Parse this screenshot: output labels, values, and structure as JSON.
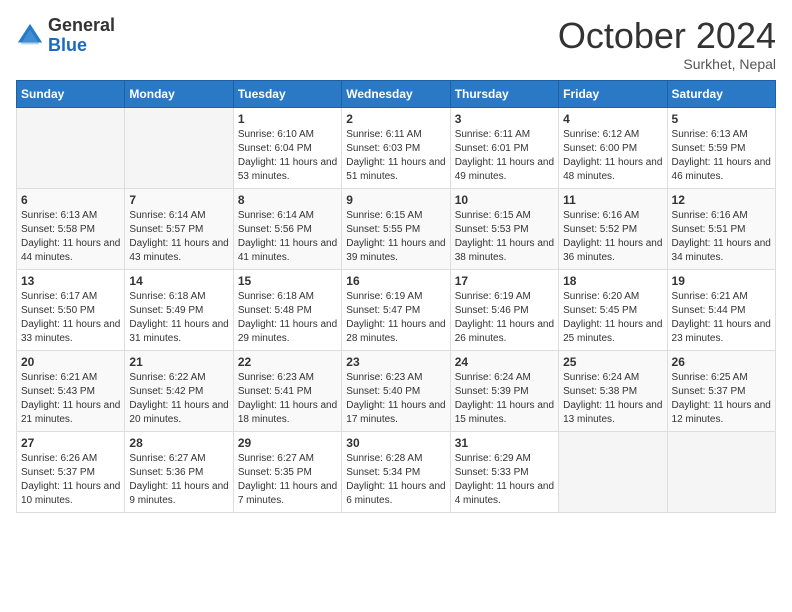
{
  "logo": {
    "general": "General",
    "blue": "Blue"
  },
  "header": {
    "month": "October 2024",
    "location": "Surkhet, Nepal"
  },
  "weekdays": [
    "Sunday",
    "Monday",
    "Tuesday",
    "Wednesday",
    "Thursday",
    "Friday",
    "Saturday"
  ],
  "weeks": [
    [
      {
        "day": "",
        "sunrise": "",
        "sunset": "",
        "daylight": ""
      },
      {
        "day": "",
        "sunrise": "",
        "sunset": "",
        "daylight": ""
      },
      {
        "day": "1",
        "sunrise": "Sunrise: 6:10 AM",
        "sunset": "Sunset: 6:04 PM",
        "daylight": "Daylight: 11 hours and 53 minutes."
      },
      {
        "day": "2",
        "sunrise": "Sunrise: 6:11 AM",
        "sunset": "Sunset: 6:03 PM",
        "daylight": "Daylight: 11 hours and 51 minutes."
      },
      {
        "day": "3",
        "sunrise": "Sunrise: 6:11 AM",
        "sunset": "Sunset: 6:01 PM",
        "daylight": "Daylight: 11 hours and 49 minutes."
      },
      {
        "day": "4",
        "sunrise": "Sunrise: 6:12 AM",
        "sunset": "Sunset: 6:00 PM",
        "daylight": "Daylight: 11 hours and 48 minutes."
      },
      {
        "day": "5",
        "sunrise": "Sunrise: 6:13 AM",
        "sunset": "Sunset: 5:59 PM",
        "daylight": "Daylight: 11 hours and 46 minutes."
      }
    ],
    [
      {
        "day": "6",
        "sunrise": "Sunrise: 6:13 AM",
        "sunset": "Sunset: 5:58 PM",
        "daylight": "Daylight: 11 hours and 44 minutes."
      },
      {
        "day": "7",
        "sunrise": "Sunrise: 6:14 AM",
        "sunset": "Sunset: 5:57 PM",
        "daylight": "Daylight: 11 hours and 43 minutes."
      },
      {
        "day": "8",
        "sunrise": "Sunrise: 6:14 AM",
        "sunset": "Sunset: 5:56 PM",
        "daylight": "Daylight: 11 hours and 41 minutes."
      },
      {
        "day": "9",
        "sunrise": "Sunrise: 6:15 AM",
        "sunset": "Sunset: 5:55 PM",
        "daylight": "Daylight: 11 hours and 39 minutes."
      },
      {
        "day": "10",
        "sunrise": "Sunrise: 6:15 AM",
        "sunset": "Sunset: 5:53 PM",
        "daylight": "Daylight: 11 hours and 38 minutes."
      },
      {
        "day": "11",
        "sunrise": "Sunrise: 6:16 AM",
        "sunset": "Sunset: 5:52 PM",
        "daylight": "Daylight: 11 hours and 36 minutes."
      },
      {
        "day": "12",
        "sunrise": "Sunrise: 6:16 AM",
        "sunset": "Sunset: 5:51 PM",
        "daylight": "Daylight: 11 hours and 34 minutes."
      }
    ],
    [
      {
        "day": "13",
        "sunrise": "Sunrise: 6:17 AM",
        "sunset": "Sunset: 5:50 PM",
        "daylight": "Daylight: 11 hours and 33 minutes."
      },
      {
        "day": "14",
        "sunrise": "Sunrise: 6:18 AM",
        "sunset": "Sunset: 5:49 PM",
        "daylight": "Daylight: 11 hours and 31 minutes."
      },
      {
        "day": "15",
        "sunrise": "Sunrise: 6:18 AM",
        "sunset": "Sunset: 5:48 PM",
        "daylight": "Daylight: 11 hours and 29 minutes."
      },
      {
        "day": "16",
        "sunrise": "Sunrise: 6:19 AM",
        "sunset": "Sunset: 5:47 PM",
        "daylight": "Daylight: 11 hours and 28 minutes."
      },
      {
        "day": "17",
        "sunrise": "Sunrise: 6:19 AM",
        "sunset": "Sunset: 5:46 PM",
        "daylight": "Daylight: 11 hours and 26 minutes."
      },
      {
        "day": "18",
        "sunrise": "Sunrise: 6:20 AM",
        "sunset": "Sunset: 5:45 PM",
        "daylight": "Daylight: 11 hours and 25 minutes."
      },
      {
        "day": "19",
        "sunrise": "Sunrise: 6:21 AM",
        "sunset": "Sunset: 5:44 PM",
        "daylight": "Daylight: 11 hours and 23 minutes."
      }
    ],
    [
      {
        "day": "20",
        "sunrise": "Sunrise: 6:21 AM",
        "sunset": "Sunset: 5:43 PM",
        "daylight": "Daylight: 11 hours and 21 minutes."
      },
      {
        "day": "21",
        "sunrise": "Sunrise: 6:22 AM",
        "sunset": "Sunset: 5:42 PM",
        "daylight": "Daylight: 11 hours and 20 minutes."
      },
      {
        "day": "22",
        "sunrise": "Sunrise: 6:23 AM",
        "sunset": "Sunset: 5:41 PM",
        "daylight": "Daylight: 11 hours and 18 minutes."
      },
      {
        "day": "23",
        "sunrise": "Sunrise: 6:23 AM",
        "sunset": "Sunset: 5:40 PM",
        "daylight": "Daylight: 11 hours and 17 minutes."
      },
      {
        "day": "24",
        "sunrise": "Sunrise: 6:24 AM",
        "sunset": "Sunset: 5:39 PM",
        "daylight": "Daylight: 11 hours and 15 minutes."
      },
      {
        "day": "25",
        "sunrise": "Sunrise: 6:24 AM",
        "sunset": "Sunset: 5:38 PM",
        "daylight": "Daylight: 11 hours and 13 minutes."
      },
      {
        "day": "26",
        "sunrise": "Sunrise: 6:25 AM",
        "sunset": "Sunset: 5:37 PM",
        "daylight": "Daylight: 11 hours and 12 minutes."
      }
    ],
    [
      {
        "day": "27",
        "sunrise": "Sunrise: 6:26 AM",
        "sunset": "Sunset: 5:37 PM",
        "daylight": "Daylight: 11 hours and 10 minutes."
      },
      {
        "day": "28",
        "sunrise": "Sunrise: 6:27 AM",
        "sunset": "Sunset: 5:36 PM",
        "daylight": "Daylight: 11 hours and 9 minutes."
      },
      {
        "day": "29",
        "sunrise": "Sunrise: 6:27 AM",
        "sunset": "Sunset: 5:35 PM",
        "daylight": "Daylight: 11 hours and 7 minutes."
      },
      {
        "day": "30",
        "sunrise": "Sunrise: 6:28 AM",
        "sunset": "Sunset: 5:34 PM",
        "daylight": "Daylight: 11 hours and 6 minutes."
      },
      {
        "day": "31",
        "sunrise": "Sunrise: 6:29 AM",
        "sunset": "Sunset: 5:33 PM",
        "daylight": "Daylight: 11 hours and 4 minutes."
      },
      {
        "day": "",
        "sunrise": "",
        "sunset": "",
        "daylight": ""
      },
      {
        "day": "",
        "sunrise": "",
        "sunset": "",
        "daylight": ""
      }
    ]
  ]
}
